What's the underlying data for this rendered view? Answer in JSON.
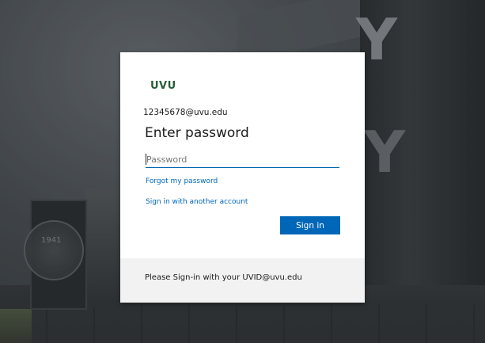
{
  "background": {
    "seal_text": "1941"
  },
  "card": {
    "logo_text": "UVU",
    "identity": "12345678@uvu.edu",
    "title": "Enter password",
    "password": {
      "value": "",
      "placeholder": "Password"
    },
    "forgot_password_link": "Forgot my password",
    "other_account_link": "Sign in with another account",
    "sign_in_button": "Sign in",
    "footer_text": "Please Sign-in with your UVID@uvu.edu"
  },
  "colors": {
    "brand_green": "#275d38",
    "accent_blue": "#0067b8",
    "footer_bg": "#f2f2f2"
  }
}
